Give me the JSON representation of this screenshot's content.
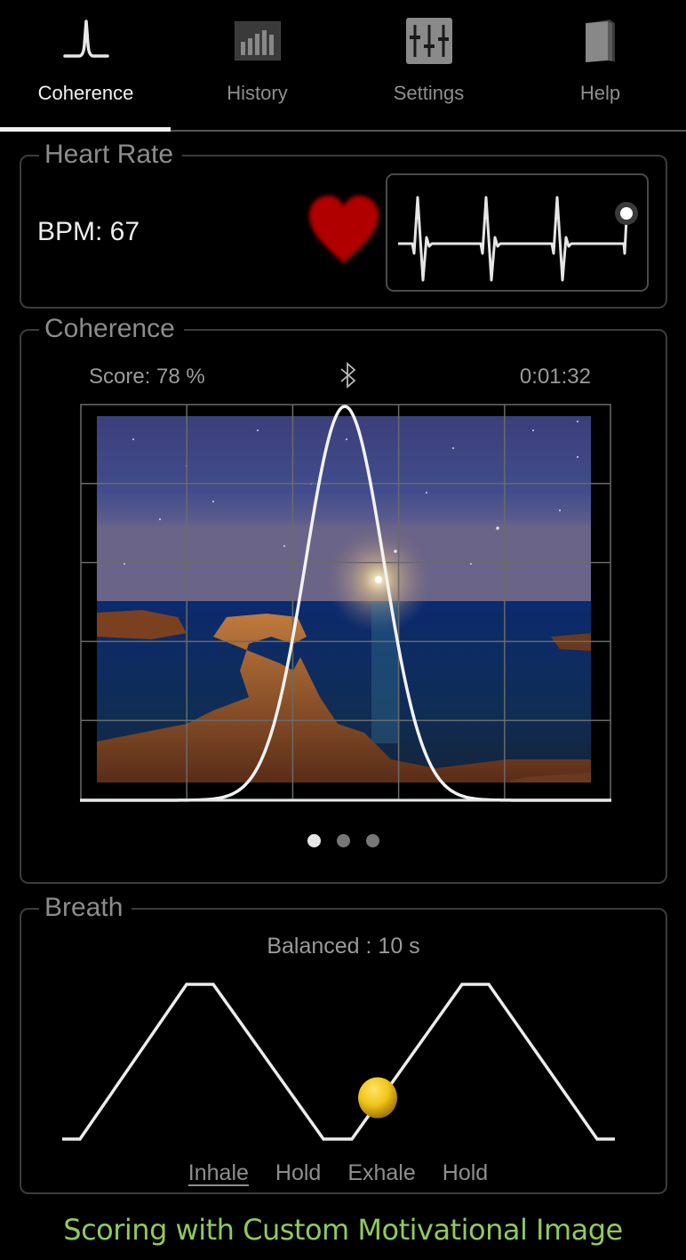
{
  "tabs": [
    {
      "label": "Coherence",
      "icon": "coherence-peak-icon",
      "active": true
    },
    {
      "label": "History",
      "icon": "bar-chart-icon",
      "active": false
    },
    {
      "label": "Settings",
      "icon": "sliders-icon",
      "active": false
    },
    {
      "label": "Help",
      "icon": "book-icon",
      "active": false
    }
  ],
  "heart_rate": {
    "title": "Heart Rate",
    "bpm_text": "BPM: 67",
    "bpm": 67,
    "heart_color": "#b00000"
  },
  "coherence": {
    "title": "Coherence",
    "score_text": "Score: 78 %",
    "score_percent": 78,
    "connection_icon": "bluetooth-icon",
    "elapsed": "0:01:32",
    "background_image": "night seascape with rock arch under starry sky",
    "grid": {
      "columns": 5,
      "rows": 5
    },
    "curve_peak_fraction": 0.5,
    "pages": 3,
    "active_page": 0
  },
  "breath": {
    "title": "Breath",
    "pattern_text": "Balanced : 10 s",
    "phases": [
      {
        "label": "Inhale",
        "active": true
      },
      {
        "label": "Hold",
        "active": false
      },
      {
        "label": "Exhale",
        "active": false
      },
      {
        "label": "Hold",
        "active": false
      }
    ],
    "ball_color": "#f0c419",
    "progress_fraction": 0.57
  },
  "caption": "Scoring with Custom Motivational Image",
  "colors": {
    "accent_text": "#f2f2f2",
    "muted_text": "#8e8e8e",
    "caption": "#92c95a",
    "border": "#3c3c3c"
  }
}
